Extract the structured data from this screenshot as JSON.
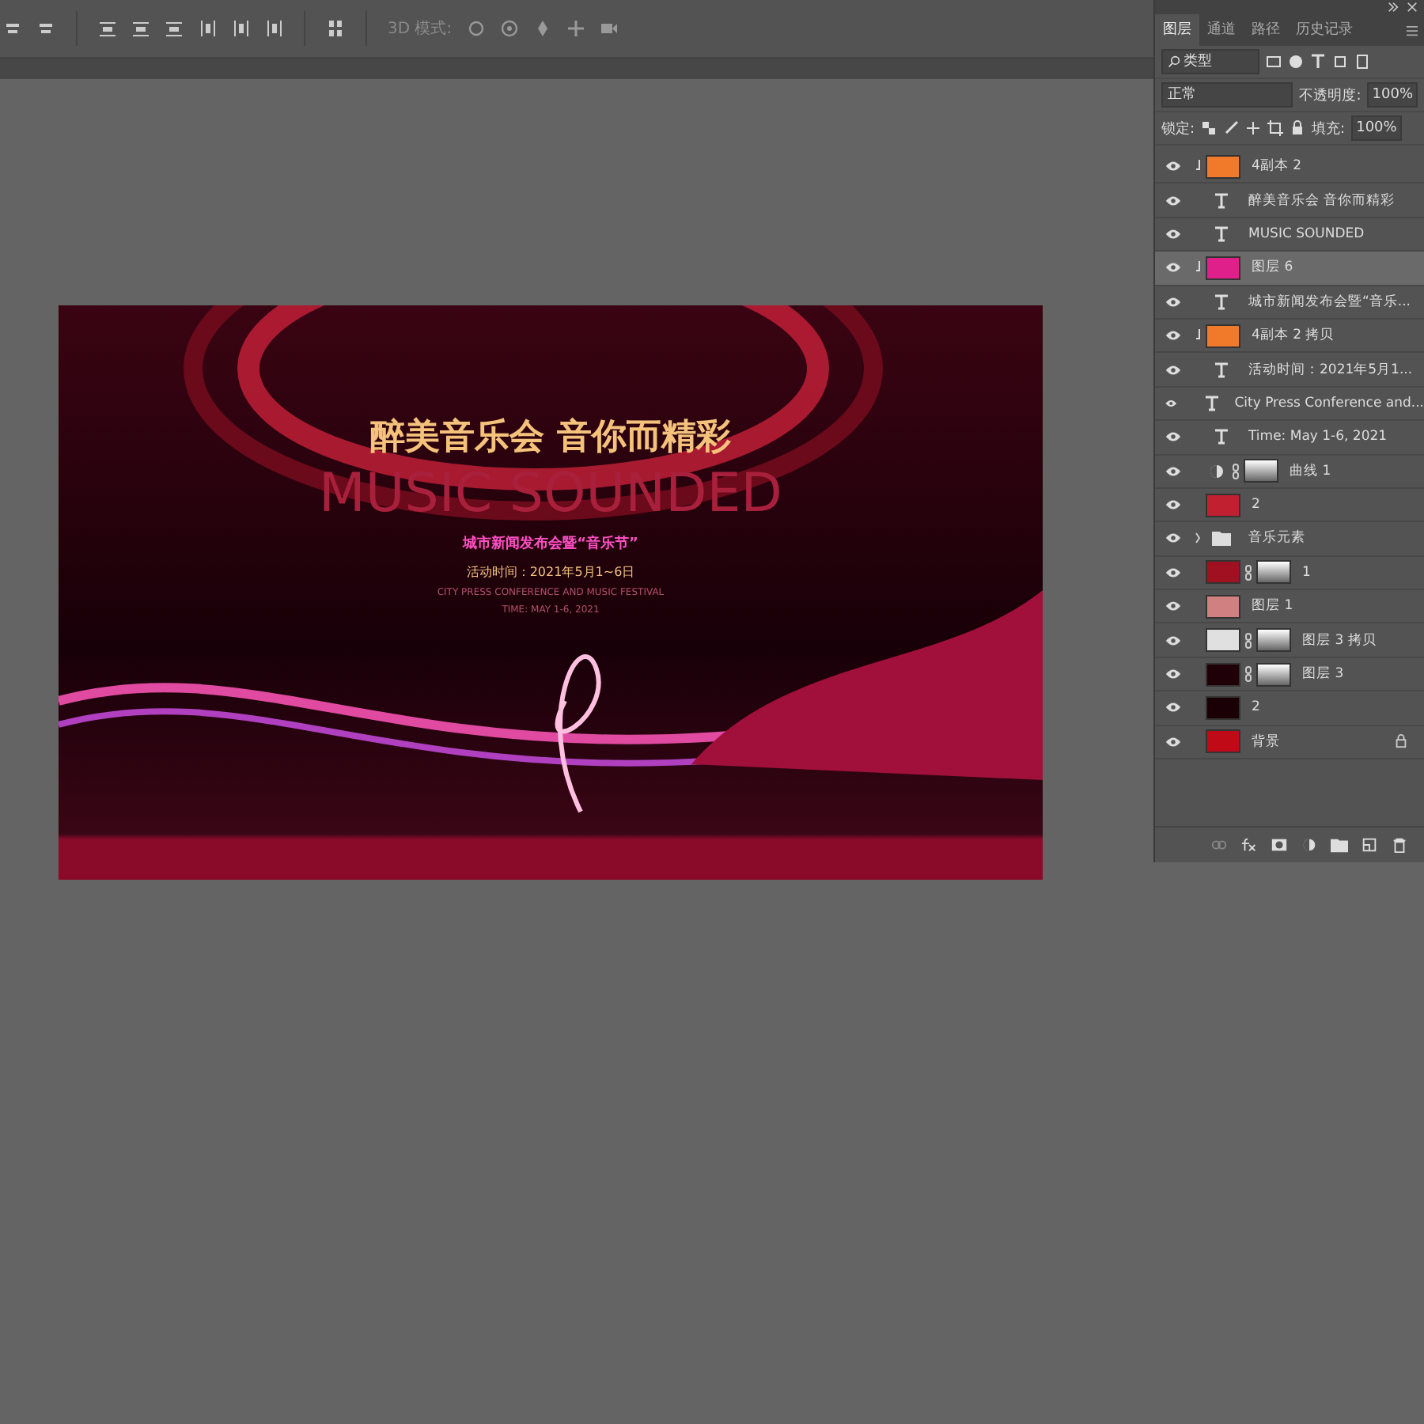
{
  "options_bar": {
    "mode_label": "3D 模式:"
  },
  "canvas": {
    "poster": {
      "title": "醉美音乐会 音你而精彩",
      "subtitle": "MUSIC SOUNDED",
      "event": "城市新闻发布会暨“音乐节”",
      "date": "活动时间：2021年5月1~6日",
      "english_event": "CITY PRESS CONFERENCE AND MUSIC FESTIVAL",
      "english_date": "TIME: MAY 1-6, 2021"
    }
  },
  "panel": {
    "tabs": [
      {
        "label": "图层",
        "selected": true
      },
      {
        "label": "通道",
        "selected": false
      },
      {
        "label": "路径",
        "selected": false
      },
      {
        "label": "历史记录",
        "selected": false
      }
    ],
    "filter": "类型",
    "blend_mode": "正常",
    "opacity_label": "不透明度:",
    "opacity": "100%",
    "lock_label": "锁定:",
    "fill_label": "填充:",
    "fill": "100%",
    "layers": [
      {
        "kind": "image",
        "name": "4副本 2",
        "visible": true,
        "selected": false,
        "clipped": true,
        "mask": false,
        "locked": false,
        "color": "#f07a2a"
      },
      {
        "kind": "text",
        "name": "醉美音乐会 音你而精彩",
        "visible": true,
        "selected": false
      },
      {
        "kind": "text",
        "name": "MUSIC SOUNDED",
        "visible": true,
        "selected": false
      },
      {
        "kind": "image",
        "name": "图层 6",
        "visible": true,
        "selected": true,
        "clipped": true,
        "mask": false,
        "locked": false,
        "color": "#e0208a"
      },
      {
        "kind": "text",
        "name": "城市新闻发布会暨“音乐...",
        "visible": true,
        "selected": false
      },
      {
        "kind": "image",
        "name": "4副本 2 拷贝",
        "visible": true,
        "selected": false,
        "clipped": true,
        "mask": false,
        "locked": false,
        "color": "#f07a2a"
      },
      {
        "kind": "text",
        "name": "活动时间：2021年5月1...",
        "visible": true,
        "selected": false
      },
      {
        "kind": "text",
        "name": "City Press Conference and...",
        "visible": true,
        "selected": false
      },
      {
        "kind": "text",
        "name": "Time: May 1-6, 2021",
        "visible": true,
        "selected": false
      },
      {
        "kind": "adjustment",
        "name": "曲线 1",
        "visible": true,
        "selected": false
      },
      {
        "kind": "image",
        "name": "2",
        "visible": true,
        "selected": false,
        "clipped": false,
        "mask": false,
        "locked": false,
        "color": "#c02030"
      },
      {
        "kind": "group",
        "name": "音乐元素",
        "visible": true,
        "selected": false
      },
      {
        "kind": "image",
        "name": "1",
        "visible": true,
        "selected": false,
        "clipped": false,
        "mask": true,
        "locked": false,
        "color": "#a01020"
      },
      {
        "kind": "image",
        "name": "图层 1",
        "visible": true,
        "selected": false,
        "clipped": false,
        "mask": false,
        "locked": false,
        "color": "#d08080"
      },
      {
        "kind": "image",
        "name": "图层 3 拷贝",
        "visible": true,
        "selected": false,
        "clipped": false,
        "mask": true,
        "locked": false,
        "color": "#e0e0e0"
      },
      {
        "kind": "image",
        "name": "图层 3",
        "visible": true,
        "selected": false,
        "clipped": false,
        "mask": true,
        "locked": false,
        "color": "#200008"
      },
      {
        "kind": "image",
        "name": "2",
        "visible": true,
        "selected": false,
        "clipped": false,
        "mask": false,
        "locked": false,
        "color": "#1a0006"
      },
      {
        "kind": "image",
        "name": "背景",
        "visible": true,
        "selected": false,
        "clipped": false,
        "mask": false,
        "locked": true,
        "color": "#c00a18"
      }
    ]
  }
}
